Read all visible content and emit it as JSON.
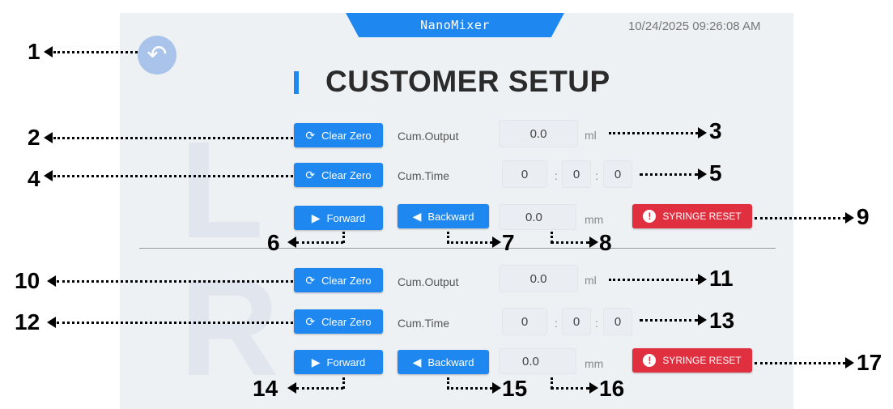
{
  "header": {
    "brand": "NanoMixer",
    "datetime": "10/24/2025 09:26:08 AM"
  },
  "page_title": "CUSTOMER SETUP",
  "watermarks": {
    "top": "L",
    "bottom": "R"
  },
  "icons": {
    "back": "back-arrow-icon",
    "refresh": "refresh-icon",
    "forward": "play-right-icon",
    "backward": "play-left-icon",
    "alert": "alert-icon"
  },
  "colors": {
    "accent": "#1e88f0",
    "danger": "#e03040",
    "background": "#eef1f4"
  },
  "left_pump": {
    "output": {
      "clear_label": "Clear Zero",
      "label": "Cum.Output",
      "value": "0.0",
      "unit": "ml"
    },
    "time": {
      "clear_label": "Clear Zero",
      "label": "Cum.Time",
      "h": "0",
      "m": "0",
      "s": "0",
      "sep": ":"
    },
    "jog": {
      "forward_label": "Forward",
      "backward_label": "Backward",
      "distance": "0.0",
      "unit": "mm",
      "reset_label": "SYRINGE RESET"
    }
  },
  "right_pump": {
    "output": {
      "clear_label": "Clear Zero",
      "label": "Cum.Output",
      "value": "0.0",
      "unit": "ml"
    },
    "time": {
      "clear_label": "Clear Zero",
      "label": "Cum.Time",
      "h": "0",
      "m": "0",
      "s": "0",
      "sep": ":"
    },
    "jog": {
      "forward_label": "Forward",
      "backward_label": "Backward",
      "distance": "0.0",
      "unit": "mm",
      "reset_label": "SYRINGE RESET"
    }
  },
  "callouts": [
    "1",
    "2",
    "3",
    "4",
    "5",
    "6",
    "7",
    "8",
    "9",
    "10",
    "11",
    "12",
    "13",
    "14",
    "15",
    "16",
    "17"
  ]
}
